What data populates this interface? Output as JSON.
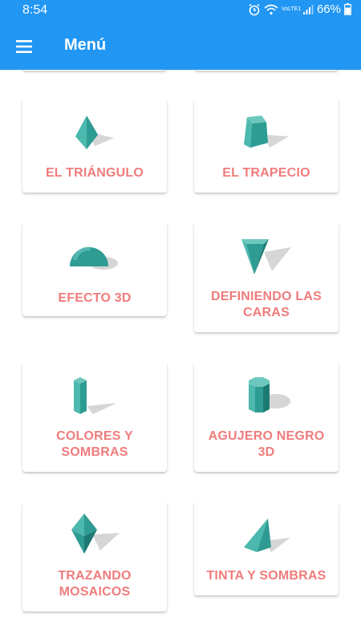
{
  "status_bar": {
    "time": "8:54",
    "battery": "66%",
    "network": "VoLTE1"
  },
  "app_bar": {
    "title": "Menú"
  },
  "cards": [
    {
      "label": "EL TRIÁNGULO",
      "icon": "tetrahedron-icon"
    },
    {
      "label": "EL TRAPECIO",
      "icon": "truncated-pyramid-icon"
    },
    {
      "label": "EFECTO 3D",
      "icon": "hemisphere-icon"
    },
    {
      "label": "DEFINIENDO LAS CARAS",
      "icon": "inverted-prism-icon"
    },
    {
      "label": "COLORES Y SOMBRAS",
      "icon": "rectangular-prism-icon"
    },
    {
      "label": "AGUJERO NEGRO 3D",
      "icon": "octagonal-prism-icon"
    },
    {
      "label": "TRAZANDO MOSAICOS",
      "icon": "octahedron-icon"
    },
    {
      "label": "TINTA Y SOMBRAS",
      "icon": "pyramid-icon"
    }
  ],
  "colors": {
    "primary": "#2196f3",
    "label": "#f07c7c",
    "shape_light": "#4cb8ae",
    "shape_mid": "#2e9c93",
    "shape_dark": "#1d7a72"
  }
}
